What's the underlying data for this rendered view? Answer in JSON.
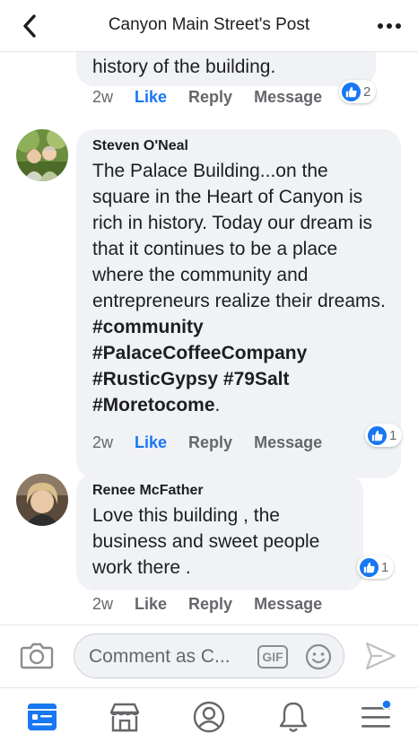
{
  "header": {
    "title": "Canyon Main Street's Post"
  },
  "comments": [
    {
      "text_partial": "history of the building.",
      "time": "2w",
      "like_label": "Like",
      "reply_label": "Reply",
      "message_label": "Message",
      "reaction_count": "2"
    },
    {
      "author": "Steven O'Neal",
      "text_plain": "The Palace Building...on the square in the Heart of Canyon is rich in history. Today our dream is that it continues to be a place where the community and entrepreneurs realize their dreams. ",
      "hashtags": [
        "#community",
        "#PalaceCoffeeCompany",
        "#RusticGypsy",
        "#79Salt",
        "#Moretocome"
      ],
      "text_end": ".",
      "time": "2w",
      "like_label": "Like",
      "reply_label": "Reply",
      "message_label": "Message",
      "reaction_count": "1"
    },
    {
      "author": "Renee McFather",
      "text": "Love this building , the business and sweet people work there .",
      "time": "2w",
      "like_label": "Like",
      "reply_label": "Reply",
      "message_label": "Message",
      "reaction_count": "1"
    }
  ],
  "composer": {
    "placeholder": "Comment as C...",
    "gif_label": "GIF"
  },
  "colors": {
    "accent": "#1877f2",
    "bubble": "#f0f2f5",
    "secondary_text": "#65676b"
  }
}
